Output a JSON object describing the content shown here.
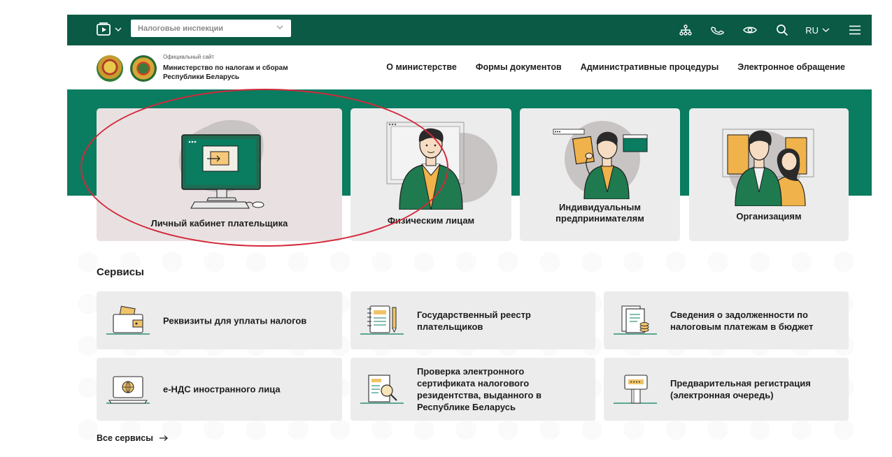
{
  "topbar": {
    "select_value": "Налоговые инспекции",
    "lang": "RU",
    "icons": [
      "structure-icon",
      "phone-icon",
      "eye-icon",
      "search-icon",
      "menu-icon"
    ],
    "bg_color": "#0a5a45"
  },
  "header": {
    "site_small": "Официальный сайт",
    "site_name_line1": "Министерство по налогам и сборам",
    "site_name_line2": "Республики Беларусь",
    "nav": [
      "О министерстве",
      "Формы документов",
      "Административные процедуры",
      "Электронное обращение"
    ]
  },
  "hero": {
    "bg_color": "#0a7c60",
    "cards": [
      {
        "label": "Личный кабинет плательщика"
      },
      {
        "label": "Физическим лицам"
      },
      {
        "label_line1": "Индивидуальным",
        "label_line2": "предпринимателям"
      },
      {
        "label": "Организациям"
      }
    ]
  },
  "services": {
    "title": "Сервисы",
    "items": [
      {
        "line1": "Реквизиты для уплаты налогов",
        "icon": "wallet-icon"
      },
      {
        "line1": "Государственный реестр",
        "line2": "плательщиков",
        "icon": "notebook-icon"
      },
      {
        "line1": "Сведения о задолженности по",
        "line2": "налоговым платежам в бюджет",
        "icon": "documents-coins-icon"
      },
      {
        "line1": "е-НДС иностранного лица",
        "icon": "laptop-globe-icon"
      },
      {
        "line1": "Проверка электронного",
        "line2": "сертификата налогового",
        "line3": "резидентства, выданного в",
        "line4": "Республике Беларусь",
        "icon": "document-search-icon"
      },
      {
        "line1": "Предварительная регистрация",
        "line2": "(электронная очередь)",
        "icon": "queue-terminal-icon"
      }
    ],
    "all_link": "Все сервисы"
  },
  "annotation": {
    "color": "#d3293b"
  }
}
